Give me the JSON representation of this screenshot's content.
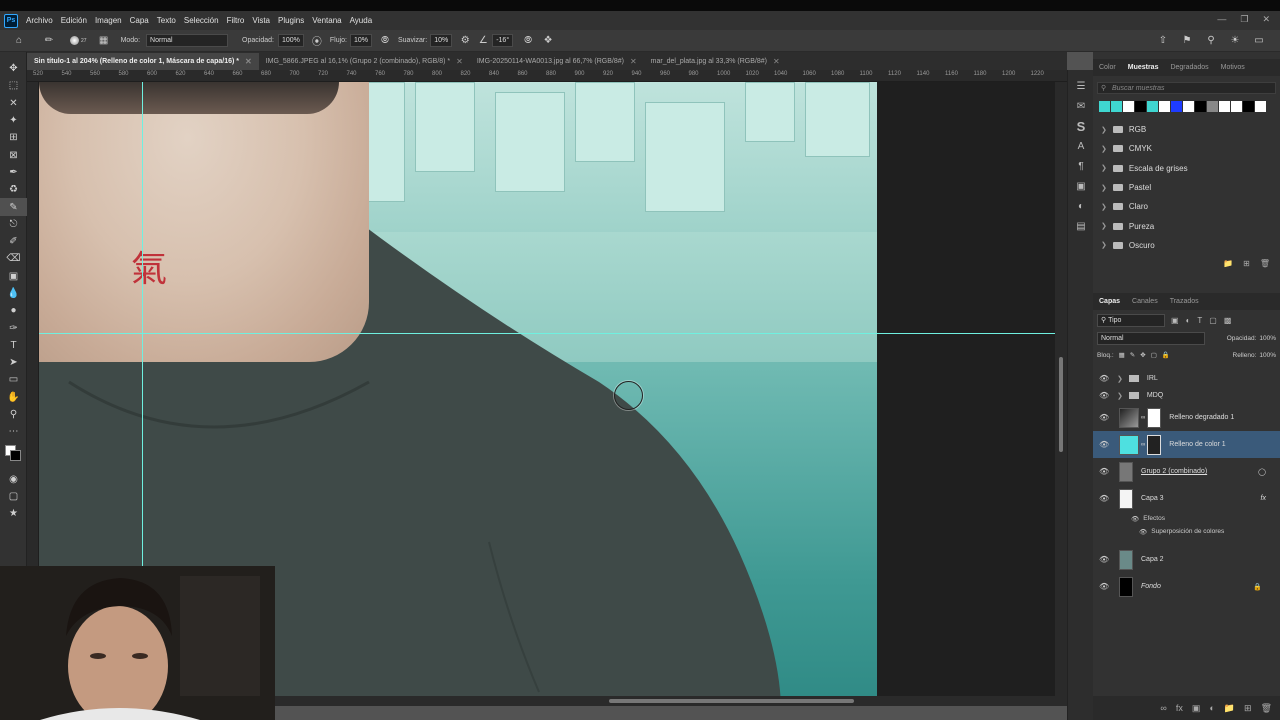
{
  "app": {
    "logo": "Ps",
    "menu": [
      "Archivo",
      "Edición",
      "Imagen",
      "Capa",
      "Texto",
      "Selección",
      "Filtro",
      "Vista",
      "Plugins",
      "Ventana",
      "Ayuda"
    ]
  },
  "options": {
    "brush_size": "27",
    "mode_label": "Modo:",
    "mode_value": "Normal",
    "opacity_label": "Opacidad:",
    "opacity_value": "100%",
    "flow_label": "Flujo:",
    "flow_value": "10%",
    "smooth_label": "Suavizar:",
    "smooth_value": "10%",
    "angle_value": "-16°"
  },
  "tabs": [
    {
      "label": "Sin título-1 al 204% (Relleno de color 1, Máscara de capa/16) *"
    },
    {
      "label": "IMG_5866.JPEG al 16,1% (Grupo 2 (combinado), RGB/8) *"
    },
    {
      "label": "IMG-20250114-WA0013.jpg al 66,7% (RGB/8#)"
    },
    {
      "label": "mar_del_plata.jpg al 33,3% (RGB/8#)"
    }
  ],
  "ruler": [
    "520",
    "540",
    "560",
    "580",
    "600",
    "620",
    "640",
    "660",
    "680",
    "700",
    "720",
    "740",
    "760",
    "780",
    "800",
    "820",
    "840",
    "860",
    "880",
    "900",
    "920",
    "940",
    "960",
    "980",
    "1000",
    "1020",
    "1040",
    "1060",
    "1080",
    "1100",
    "1120",
    "1140",
    "1160",
    "1180",
    "1200",
    "1220"
  ],
  "canvas": {
    "tattoo": "氣"
  },
  "swatches_panel": {
    "tabs": [
      "Color",
      "Muestras",
      "Degradados",
      "Motivos"
    ],
    "search_placeholder": "Buscar muestras",
    "colors": [
      "#3fd6d0",
      "#3fd6d0",
      "#ffffff",
      "#000000",
      "#3fd6d0",
      "#ffffff",
      "#1e3cff",
      "#ffffff",
      "#000000",
      "#888888",
      "#ffffff",
      "#ffffff",
      "#000000",
      "#ffffff"
    ],
    "folders": [
      "RGB",
      "CMYK",
      "Escala de grises",
      "Pastel",
      "Claro",
      "Pureza",
      "Oscuro"
    ]
  },
  "layers_panel": {
    "tabs": [
      "Capas",
      "Canales",
      "Trazados"
    ],
    "filter": "Tipo",
    "blend": "Normal",
    "opacity_label": "Opacidad:",
    "opacity_value": "100%",
    "lock_label": "Bloq.:",
    "fill_label": "Relleno:",
    "fill_value": "100%",
    "layers": [
      {
        "name": "IRL",
        "type": "group"
      },
      {
        "name": "MDQ",
        "type": "group"
      },
      {
        "name": "Relleno degradado 1",
        "type": "gradient"
      },
      {
        "name": "Relleno de color 1",
        "type": "fill",
        "selected": true
      },
      {
        "name": "Grupo 2 (combinado)",
        "type": "smart"
      },
      {
        "name": "Capa 3",
        "type": "pixel",
        "fx": "fx"
      },
      {
        "name": "Capa 2",
        "type": "pixel"
      },
      {
        "name": "Fondo",
        "type": "background"
      }
    ],
    "effects_label": "Efectos",
    "effect_name": "Superposición de colores"
  }
}
